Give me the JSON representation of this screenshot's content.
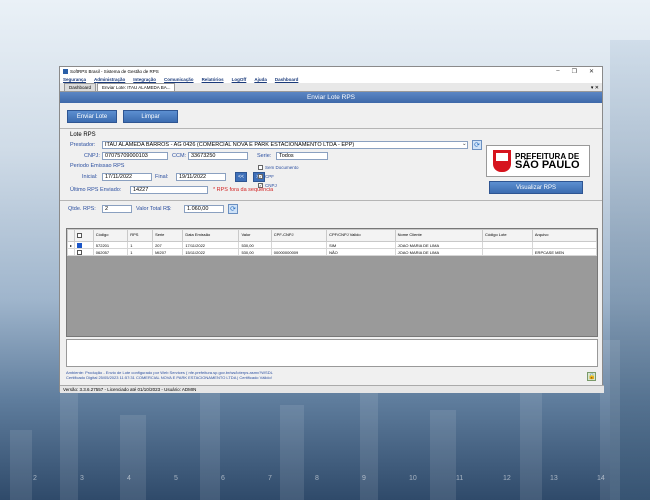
{
  "window": {
    "title": "SoftRPS Brasil - Sistema de Gestão de RPS",
    "controls": [
      "–",
      "❐",
      "✕"
    ]
  },
  "menu": [
    "Segurança",
    "Administração",
    "Integração",
    "Comunicação",
    "Relatórios",
    "LogOff",
    "Ajuda",
    "Dashboard"
  ],
  "tabs": [
    "Dashboard",
    "Enviar Lote: ITAU ALAMEDA BA..."
  ],
  "tab_controls": "▾ ✕",
  "banner": "Enviar Lote RPS",
  "toolbar": {
    "send": "Enviar Lote",
    "clear": "Limpar"
  },
  "lote": {
    "section_title": "Lote RPS",
    "prestador_label": "Prestador:",
    "prestador_value": "ITAU ALAMEDA BARROS - AG 0426 (COMERCIAL NOVA E PARK ESTACIONAMENTO LTDA - EPP)",
    "cnpj_label": "CNPJ:",
    "cnpj_value": "07075709000103",
    "ccm_label": "CCM:",
    "ccm_value": "33673250",
    "serie_label": "Serie:",
    "serie_value": "Todos",
    "periodo_label": "Periodo Emissao RPS",
    "inicial_label": "Inicial:",
    "inicial_value": "17/11/2022",
    "final_label": "Final:",
    "final_value": "19/11/2022",
    "prev_btn": "<<",
    "next_btn": ">>",
    "checks": [
      {
        "label": "Sem Documento",
        "checked": false
      },
      {
        "label": "CPF",
        "checked": true
      },
      {
        "label": "CNPJ",
        "checked": true
      }
    ],
    "ultimo_label": "Último RPS Enviado:",
    "ultimo_value": "14227",
    "warning": "* RPS fora da sequência",
    "logo_line1": "PREFEITURA DE",
    "logo_line2": "SÃO PAULO",
    "visualizar": "Visualizar RPS"
  },
  "totals": {
    "qtde_label": "Qtde. RPS:",
    "qtde_value": "2",
    "valor_label": "Valor Total R$:",
    "valor_value": "1.060,00"
  },
  "grid": {
    "headers": [
      "",
      "Código",
      "RPS",
      "Serie",
      "Data Emissão",
      "Valor",
      "CPF-CNPJ",
      "CPF/CNPJ Valido",
      "Nome Cliente",
      "Código Lote",
      "Arquivo"
    ],
    "rows": [
      {
        "marker": "▸",
        "checked": true,
        "codigo": "572201",
        "rps": "1",
        "serie": "207",
        "data": "17/11/2022",
        "valor": "530,00",
        "doc": "",
        "valido": "SIM",
        "nome": "JOAO MARIA DE LIMA",
        "lote": "",
        "arquivo": ""
      },
      {
        "marker": "",
        "checked": false,
        "codigo": "062057",
        "rps": "1",
        "serie": "MI207",
        "data": "15/11/2022",
        "valor": "530,00",
        "doc": "00000000009",
        "valido": "NÃO",
        "nome": "JOAO MARIA DE LIMA",
        "lote": "",
        "arquivo": "ERPCASE MEN"
      }
    ]
  },
  "status": {
    "line1": "Ambiente: Produção - Envio de Lote configurado por Web Services ( nfe.prefeitura.sp.gov.br/ws/loterps.asmx?WSDL",
    "line2": "Certificado Digital      25/05/2023 11:57:31 COMERCIAL NOVA E PARK ESTACIONAMENTO LTDA | Certificado Válido!"
  },
  "footer": "Versão: 3.3.6.27557 - Licenciado até 01/10/2023 - Usuário: ADMIN",
  "background_axis": [
    "2",
    "3",
    "4",
    "5",
    "6",
    "7",
    "8",
    "9",
    "10",
    "11",
    "12",
    "13",
    "14"
  ]
}
